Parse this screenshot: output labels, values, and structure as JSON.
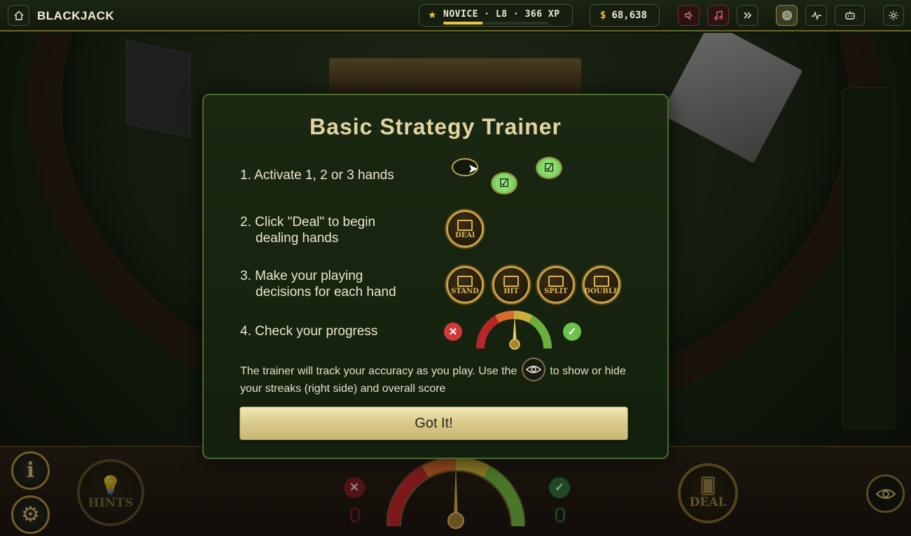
{
  "topbar": {
    "title": "BLACKJACK",
    "level": "NOVICE · L8 · 366 XP",
    "xp_progress": 0.37,
    "currency_symbol": "$",
    "balance": "68,638",
    "icons": [
      "home-icon",
      "sound-icon",
      "music-icon",
      "fast-forward-icon",
      "target-icon",
      "activity-icon",
      "robot-icon",
      "gear-icon"
    ]
  },
  "modal": {
    "title": "Basic Strategy Trainer",
    "steps": [
      {
        "num": "1.",
        "line1": "Activate 1, 2 or 3 hands",
        "line2": ""
      },
      {
        "num": "2.",
        "line1": "Click \"Deal\" to begin",
        "line2": "dealing hands"
      },
      {
        "num": "3.",
        "line1": "Make your playing",
        "line2": "decisions for each hand"
      },
      {
        "num": "4.",
        "line1": "Check your progress",
        "line2": ""
      }
    ],
    "action_labels": {
      "deal": "DEAl",
      "stand": "STAND",
      "hit": "HIT",
      "split": "SPLIT",
      "double": "DOUBLE"
    },
    "note_before": "The trainer will track your accuracy as you play. Use the",
    "note_after": "to show or hide your streaks (right side) and overall score",
    "button": "Got It!"
  },
  "bottom": {
    "hints_label": "HINTS",
    "deal_label": "DEAL",
    "wrong_count": "0",
    "right_count": "0"
  },
  "colors": {
    "accent_gold": "#c9a24a",
    "wrong": "#d23a3a",
    "right": "#6cc24a",
    "felt": "#1e2916"
  }
}
